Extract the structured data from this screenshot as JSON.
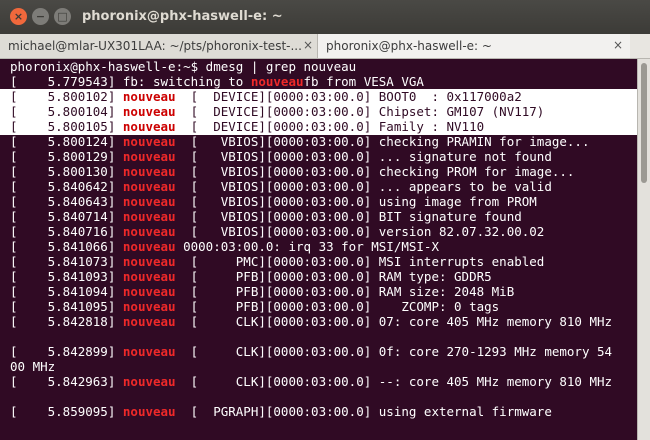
{
  "window": {
    "title": "phoronix@phx-haswell-e: ~",
    "close_glyph": "×",
    "min_glyph": "−",
    "max_glyph": "□"
  },
  "tabs": [
    {
      "label": "michael@mlar-UX301LAA: ~/pts/phoronix-test-...",
      "close_glyph": "×"
    },
    {
      "label": "phoronix@phx-haswell-e: ~",
      "close_glyph": "×"
    }
  ],
  "terminal": {
    "prompt": "phoronix@phx-haswell-e:~$ dmesg | grep nouveau",
    "lines": [
      {
        "pre": "[    5.779543] fb: switching to ",
        "nv": "nouveau",
        "post": "fb from VESA VGA"
      },
      {
        "pre": "[    5.800102] ",
        "nv": "nouveau",
        "post": "  [  DEVICE][0000:03:00.0] BOOT0  : 0x117000a2"
      },
      {
        "pre": "[    5.800104] ",
        "nv": "nouveau",
        "post": "  [  DEVICE][0000:03:00.0] Chipset: GM107 (NV117)"
      },
      {
        "pre": "[    5.800105] ",
        "nv": "nouveau",
        "post": "  [  DEVICE][0000:03:00.0] Family : NV110"
      },
      {
        "pre": "[    5.800124] ",
        "nv": "nouveau",
        "post": "  [   VBIOS][0000:03:00.0] checking PRAMIN for image..."
      },
      {
        "pre": "[    5.800129] ",
        "nv": "nouveau",
        "post": "  [   VBIOS][0000:03:00.0] ... signature not found"
      },
      {
        "pre": "[    5.800130] ",
        "nv": "nouveau",
        "post": "  [   VBIOS][0000:03:00.0] checking PROM for image..."
      },
      {
        "pre": "[    5.840642] ",
        "nv": "nouveau",
        "post": "  [   VBIOS][0000:03:00.0] ... appears to be valid"
      },
      {
        "pre": "[    5.840643] ",
        "nv": "nouveau",
        "post": "  [   VBIOS][0000:03:00.0] using image from PROM"
      },
      {
        "pre": "[    5.840714] ",
        "nv": "nouveau",
        "post": "  [   VBIOS][0000:03:00.0] BIT signature found"
      },
      {
        "pre": "[    5.840716] ",
        "nv": "nouveau",
        "post": "  [   VBIOS][0000:03:00.0] version 82.07.32.00.02"
      },
      {
        "pre": "[    5.841066] ",
        "nv": "nouveau",
        "post": " 0000:03:00.0: irq 33 for MSI/MSI-X"
      },
      {
        "pre": "[    5.841073] ",
        "nv": "nouveau",
        "post": "  [     PMC][0000:03:00.0] MSI interrupts enabled"
      },
      {
        "pre": "[    5.841093] ",
        "nv": "nouveau",
        "post": "  [     PFB][0000:03:00.0] RAM type: GDDR5"
      },
      {
        "pre": "[    5.841094] ",
        "nv": "nouveau",
        "post": "  [     PFB][0000:03:00.0] RAM size: 2048 MiB"
      },
      {
        "pre": "[    5.841095] ",
        "nv": "nouveau",
        "post": "  [     PFB][0000:03:00.0]    ZCOMP: 0 tags"
      },
      {
        "pre": "[    5.842818] ",
        "nv": "nouveau",
        "post": "  [     CLK][0000:03:00.0] 07: core 405 MHz memory 810 MHz"
      },
      {
        "pre": "",
        "nv": "",
        "post": ""
      },
      {
        "pre": "[    5.842899] ",
        "nv": "nouveau",
        "post": "  [     CLK][0000:03:00.0] 0f: core 270-1293 MHz memory 54"
      },
      {
        "pre": "00 MHz",
        "nv": "",
        "post": ""
      },
      {
        "pre": "[    5.842963] ",
        "nv": "nouveau",
        "post": "  [     CLK][0000:03:00.0] --: core 405 MHz memory 810 MHz"
      },
      {
        "pre": "",
        "nv": "",
        "post": ""
      },
      {
        "pre": "[    5.859095] ",
        "nv": "nouveau",
        "post": "  [  PGRAPH][0000:03:00.0] using external firmware"
      }
    ]
  },
  "colors": {
    "terminal_bg": "#300a24",
    "highlight_word": "#ef2929",
    "selection_bg": "#ffffff"
  }
}
